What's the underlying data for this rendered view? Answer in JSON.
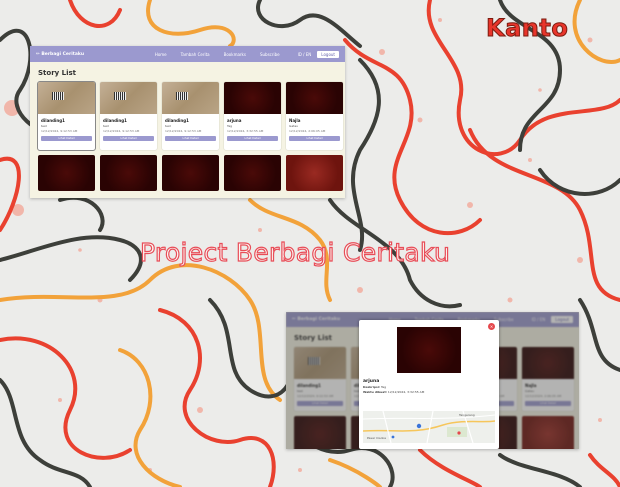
{
  "brand": "Kanto",
  "headline": "Project Berbagi Ceritaku",
  "colors": {
    "primary": "#9b99cf",
    "accent": "#e8352b",
    "background": "#ececea"
  },
  "app": {
    "logo": "✏ Berbagi Ceritaku",
    "nav": [
      "Home",
      "Tambah Cerita",
      "Bookmarks",
      "Subscribe"
    ],
    "language": "ID / EN",
    "logout": "Logout",
    "page_title": "Story List",
    "button_label": "Lihat Detail",
    "stories": [
      {
        "name": "dilanding1",
        "desc": "test",
        "date": "12/12/2024, 9:12:53 AM",
        "image": "box"
      },
      {
        "name": "dilanding1",
        "desc": "test",
        "date": "12/12/2024, 9:12:53 AM",
        "image": "box"
      },
      {
        "name": "dilanding1",
        "desc": "test",
        "date": "12/12/2024, 9:12:53 AM",
        "image": "box"
      },
      {
        "name": "arjuna",
        "desc": "Tag",
        "date": "12/12/2024, 3:32:55 AM",
        "image": "dark"
      },
      {
        "name": "Najla",
        "desc": "Gatau",
        "date": "12/12/2024, 2:06:05 AM",
        "image": "dark"
      }
    ],
    "second_row": [
      "dark",
      "dark",
      "dark",
      "dark",
      "red"
    ]
  },
  "modal": {
    "close": "×",
    "name": "arjuna",
    "desc_label": "Deskripsi:",
    "desc": "Tag",
    "date_label": "Waktu dibuat:",
    "date": "12/12/2024, 3:32:55 AM",
    "map_labels": [
      "Tangerang",
      "Pasar Cisoka"
    ]
  }
}
